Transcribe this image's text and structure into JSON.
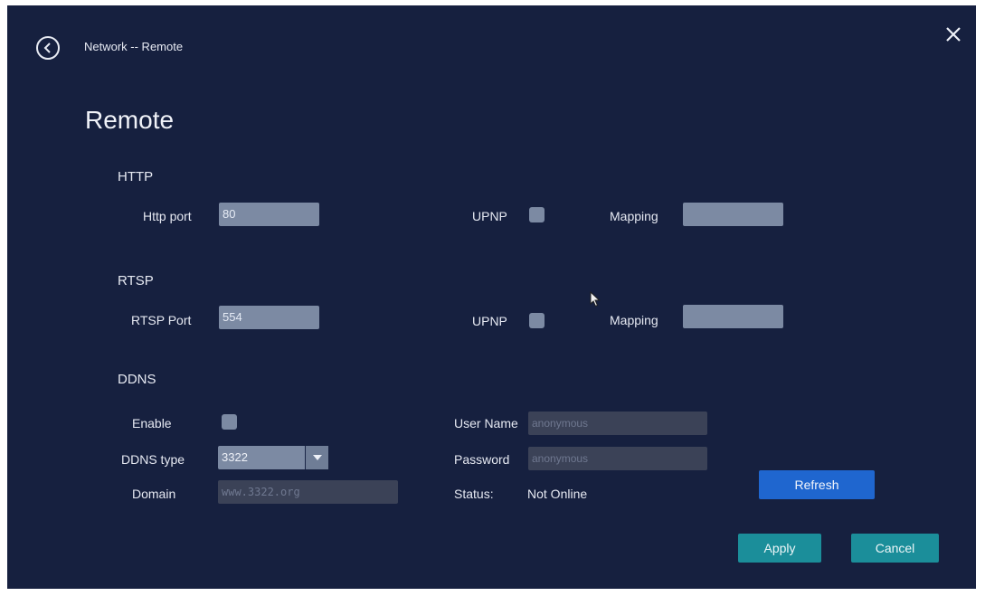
{
  "header": {
    "breadcrumb": "Network -- Remote",
    "back_icon": "chevron-left-circle-icon",
    "close_icon": "close-icon"
  },
  "page": {
    "title": "Remote"
  },
  "http": {
    "section": "HTTP",
    "port_label": "Http port",
    "port_value": "80",
    "upnp_label": "UPNP",
    "mapping_label": "Mapping",
    "mapping_value": ""
  },
  "rtsp": {
    "section": "RTSP",
    "port_label": "RTSP Port",
    "port_value": "554",
    "upnp_label": "UPNP",
    "mapping_label": "Mapping",
    "mapping_value": ""
  },
  "ddns": {
    "section": "DDNS",
    "enable_label": "Enable",
    "type_label": "DDNS type",
    "type_value": "3322",
    "domain_label": "Domain",
    "domain_value": "www.3322.org",
    "username_label": "User Name",
    "username_value": "anonymous",
    "password_label": "Password",
    "password_value": "anonymous",
    "status_label": "Status:",
    "status_value": "Not Online"
  },
  "buttons": {
    "refresh": "Refresh",
    "apply": "Apply",
    "cancel": "Cancel"
  },
  "colors": {
    "background": "#16203f",
    "field": "#7c8aa3",
    "refresh": "#1f66cf",
    "apply_cancel": "#1b8e9a"
  }
}
